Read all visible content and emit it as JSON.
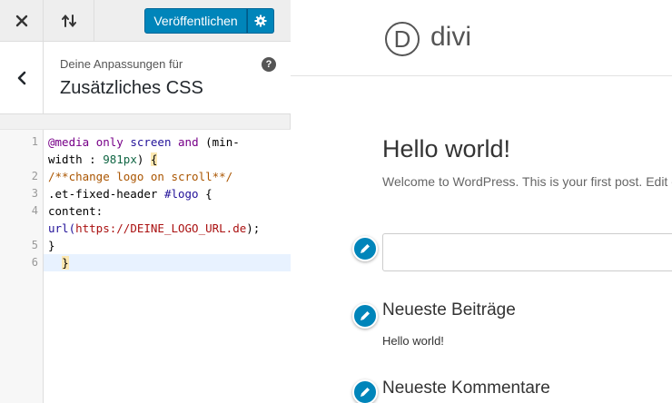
{
  "toolbar": {
    "close_icon": "close-x-icon",
    "reorder_icon": "arrows-up-down-icon",
    "publish_label": "Veröffentlichen",
    "settings_icon": "gear-icon"
  },
  "section": {
    "back_icon": "chevron-left-icon",
    "subtitle": "Deine Anpassungen für",
    "title": "Zusätzliches CSS",
    "help_label": "?"
  },
  "editor": {
    "line_numbers": [
      "1",
      "2",
      "3",
      "4",
      "5",
      "6"
    ],
    "lines": [
      [
        {
          "t": "@media",
          "c": "kw"
        },
        {
          "t": " "
        },
        {
          "t": "only",
          "c": "kw"
        },
        {
          "t": " "
        },
        {
          "t": "screen",
          "c": "atom"
        },
        {
          "t": " "
        },
        {
          "t": "and",
          "c": "kw"
        },
        {
          "t": " (min-"
        }
      ],
      [
        {
          "t": "width : "
        },
        {
          "t": "981px",
          "c": "num"
        },
        {
          "t": ") "
        },
        {
          "t": "{",
          "c": "bm"
        }
      ],
      [
        {
          "t": "/**change logo on scroll**/",
          "c": "cm"
        }
      ],
      [
        {
          "t": ".et-fixed-header "
        },
        {
          "t": "#logo",
          "c": "atom"
        },
        {
          "t": " {"
        }
      ],
      [
        {
          "t": "content:"
        }
      ],
      [
        {
          "t": "url(",
          "c": "atom"
        },
        {
          "t": "https://DEINE_LOGO_URL.de",
          "c": "str"
        },
        {
          "t": ");"
        }
      ],
      [
        {
          "t": "}"
        }
      ],
      [
        {
          "t": "  "
        },
        {
          "t": "}",
          "c": "bm"
        }
      ]
    ]
  },
  "preview": {
    "logo_letter": "D",
    "logo_text": "divi",
    "post_title": "Hello world!",
    "post_excerpt": "Welcome to WordPress. This is your first post. Edit or",
    "edit_icon": "pencil-icon",
    "widgets": [
      {
        "title": "Neueste Beiträge",
        "items": [
          "Hello world!"
        ]
      },
      {
        "title": "Neueste Kommentare",
        "items": []
      }
    ]
  },
  "colors": {
    "accent": "#0085ba",
    "panel_bg": "#f1f1f1"
  }
}
